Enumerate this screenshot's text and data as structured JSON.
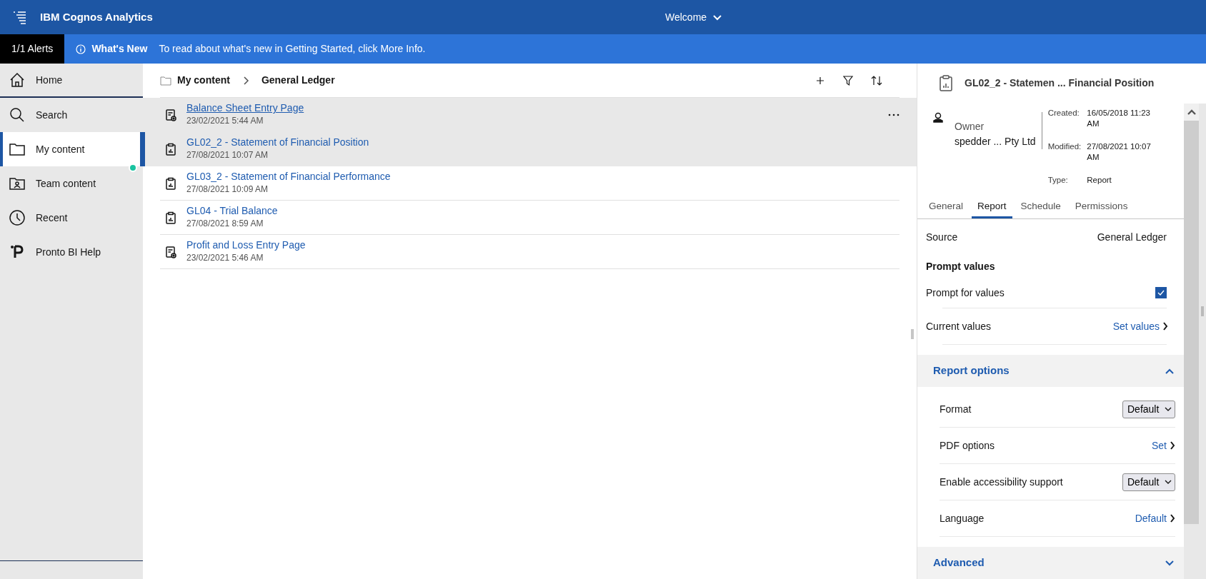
{
  "header": {
    "product": "IBM Cognos Analytics",
    "center_title": "Welcome"
  },
  "alert_bar": {
    "count": "1/1 Alerts",
    "title": "What's New",
    "message": "To read about what's new in Getting Started, click More Info."
  },
  "sidebar": {
    "items": [
      {
        "label": "Home",
        "kind": "home",
        "selected": false,
        "notification": false
      },
      {
        "label": "Search",
        "kind": "search",
        "selected": false,
        "notification": false
      },
      {
        "label": "My content",
        "kind": "folder",
        "selected": true,
        "notification": true
      },
      {
        "label": "Team content",
        "kind": "team",
        "selected": false,
        "notification": false
      },
      {
        "label": "Recent",
        "kind": "recent",
        "selected": false,
        "notification": false
      },
      {
        "label": "Pronto BI Help",
        "kind": "help",
        "selected": false,
        "notification": false
      }
    ]
  },
  "breadcrumb": [
    "My content",
    "General Ledger"
  ],
  "items": [
    {
      "name": "Balance Sheet Entry Page",
      "date": "23/02/2021 5:44 AM",
      "kind": "interactive",
      "selected": false,
      "hovered": true
    },
    {
      "name": "GL02_2 - Statement of Financial Position",
      "date": "27/08/2021 10:07 AM",
      "kind": "report",
      "selected": true,
      "hovered": false
    },
    {
      "name": "GL03_2 - Statement of Financial Performance",
      "date": "27/08/2021 10:09 AM",
      "kind": "report",
      "selected": false,
      "hovered": false
    },
    {
      "name": "GL04 - Trial Balance",
      "date": "27/08/2021 8:59 AM",
      "kind": "report",
      "selected": false,
      "hovered": false
    },
    {
      "name": "Profit and Loss Entry Page",
      "date": "23/02/2021 5:46 AM",
      "kind": "interactive",
      "selected": false,
      "hovered": false
    }
  ],
  "details": {
    "title": "GL02_2 - Statemen ... Financial Position",
    "owner_label": "Owner",
    "owner": "spedder ... Pty Ltd",
    "meta": [
      {
        "label": "Created:",
        "value": "16/05/2018 11:23 AM"
      },
      {
        "label": "Modified:",
        "value": "27/08/2021 10:07 AM"
      },
      {
        "label": "Type:",
        "value": "Report"
      }
    ],
    "tabs": [
      {
        "label": "General",
        "selected": false
      },
      {
        "label": "Report",
        "selected": true
      },
      {
        "label": "Schedule",
        "selected": false
      },
      {
        "label": "Permissions",
        "selected": false
      }
    ],
    "source": {
      "label": "Source",
      "value": "General Ledger"
    },
    "prompt_heading": "Prompt values",
    "prompt_for_values": {
      "label": "Prompt for values",
      "checked": true
    },
    "current_values": {
      "label": "Current values",
      "link": "Set values"
    },
    "sections": [
      {
        "title": "Report options",
        "expanded": true,
        "rows": [
          {
            "kind": "select",
            "label": "Format",
            "value": "Default"
          },
          {
            "kind": "link",
            "label": "PDF options",
            "value": "Set"
          },
          {
            "kind": "select",
            "label": "Enable accessibility support",
            "value": "Default"
          },
          {
            "kind": "link",
            "label": "Language",
            "value": "Default"
          }
        ]
      },
      {
        "title": "Advanced",
        "expanded": false
      }
    ]
  }
}
